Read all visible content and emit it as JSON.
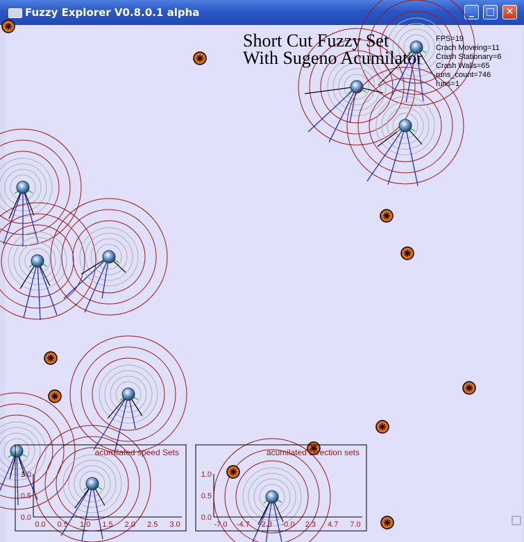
{
  "window": {
    "title": "Fuzzy Explorer V0.8.0.1 alpha"
  },
  "overlay": {
    "title_line1": "Short Cut Fuzzy Set",
    "title_line2": "With Sugeno Acumilator"
  },
  "stats": {
    "fps": "FPS=19",
    "crash_moving": "Crach Moveing=11",
    "crash_stationary": "Crash Stationary=6",
    "crash_walls": "Crash Walls=65",
    "runs_count": "runs_count=746",
    "runs": "runs=1"
  },
  "speed_plot": {
    "title": "acumilated speed Sets",
    "y_ticks": [
      "1.0",
      "0.5",
      "0.0"
    ],
    "x_ticks": [
      "0.0",
      "0.5",
      "1.0",
      "1.5",
      "2.0",
      "2.5",
      "3.0"
    ]
  },
  "direction_plot": {
    "title": "acumilated Direction sets",
    "y_ticks": [
      "1.0",
      "0.5",
      "0.0"
    ],
    "x_ticks": [
      "-7.0",
      "-4.7",
      "-2.3",
      "-0.0",
      "2.3",
      "4.7",
      "7.0"
    ]
  },
  "colors": {
    "ring": "#9c1a1a",
    "sensor": "#1a22cc",
    "whisker": "#000000",
    "green": "#22cc22",
    "mine": "#e06a10",
    "background": "#e0e0fa"
  }
}
